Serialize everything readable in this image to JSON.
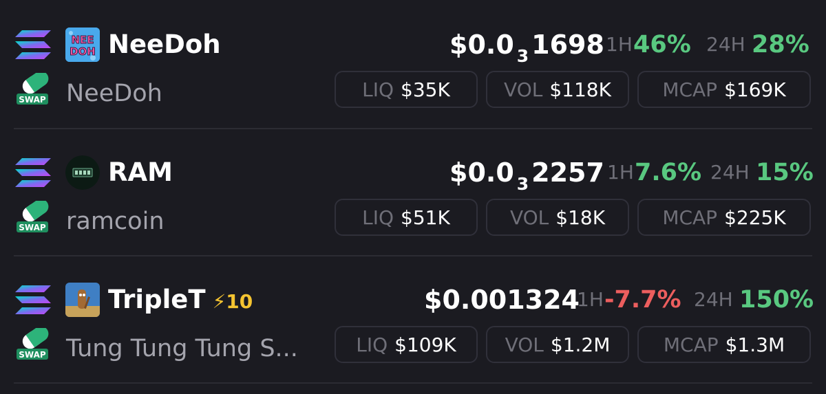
{
  "tokens": [
    {
      "symbol": "NeeDoh",
      "boost": "",
      "name": "NeeDoh",
      "price_main": "$0.0",
      "price_zeros": "3",
      "price_tail": "1698",
      "h1_label": "1H",
      "h1_change": "46%",
      "h24_label": "24H",
      "h24_change": "28%",
      "liq_label": "LIQ",
      "liq": "$35K",
      "vol_label": "VOL",
      "vol": "$118K",
      "mcap_label": "MCAP",
      "mcap": "$169K",
      "avatar_text": "NEE DOH"
    },
    {
      "symbol": "RAM",
      "boost": "",
      "name": "ramcoin",
      "price_main": "$0.0",
      "price_zeros": "3",
      "price_tail": "2257",
      "h1_label": "1H",
      "h1_change": "7.6%",
      "h24_label": "24H",
      "h24_change": "15%",
      "liq_label": "LIQ",
      "liq": "$51K",
      "vol_label": "VOL",
      "vol": "$18K",
      "mcap_label": "MCAP",
      "mcap": "$225K"
    },
    {
      "symbol": "TripleT",
      "boost": "⚡10",
      "name": "Tung Tung Tung S...",
      "price_main": "$0.001324",
      "price_zeros": "",
      "price_tail": "",
      "h1_label": "1H",
      "h1_change": "-7.7%",
      "h24_label": "24H",
      "h24_change": "150%",
      "liq_label": "LIQ",
      "liq": "$109K",
      "vol_label": "VOL",
      "vol": "$1.2M",
      "mcap_label": "MCAP",
      "mcap": "$1.3M"
    }
  ],
  "swap_badge": "SWAP",
  "colors": {
    "background": "#1b1b21",
    "positive": "#59c880",
    "negative": "#ec5e5e",
    "muted": "#6f6f78",
    "boost": "#f5c431"
  },
  "icons": {
    "chain": "solana-icon",
    "dex": "swap-icon"
  }
}
